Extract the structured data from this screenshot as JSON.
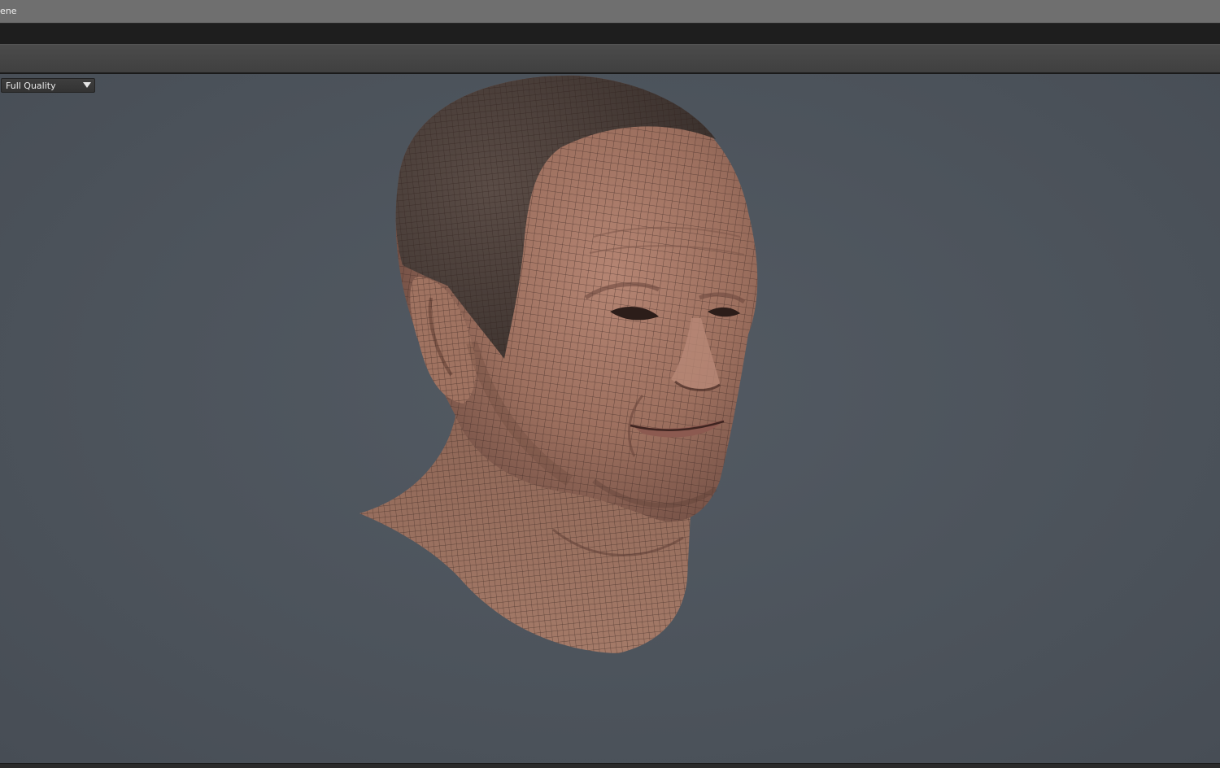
{
  "window": {
    "title": "cene"
  },
  "viewport": {
    "quality_select": {
      "selected": "Full Quality"
    },
    "model": {
      "subject": "3d-head-wireframe-icon"
    }
  },
  "colors": {
    "viewport_bg": "#4d545d",
    "skin": "#a37563",
    "hair": "#4a3f3a",
    "wire": "#3a2622"
  }
}
